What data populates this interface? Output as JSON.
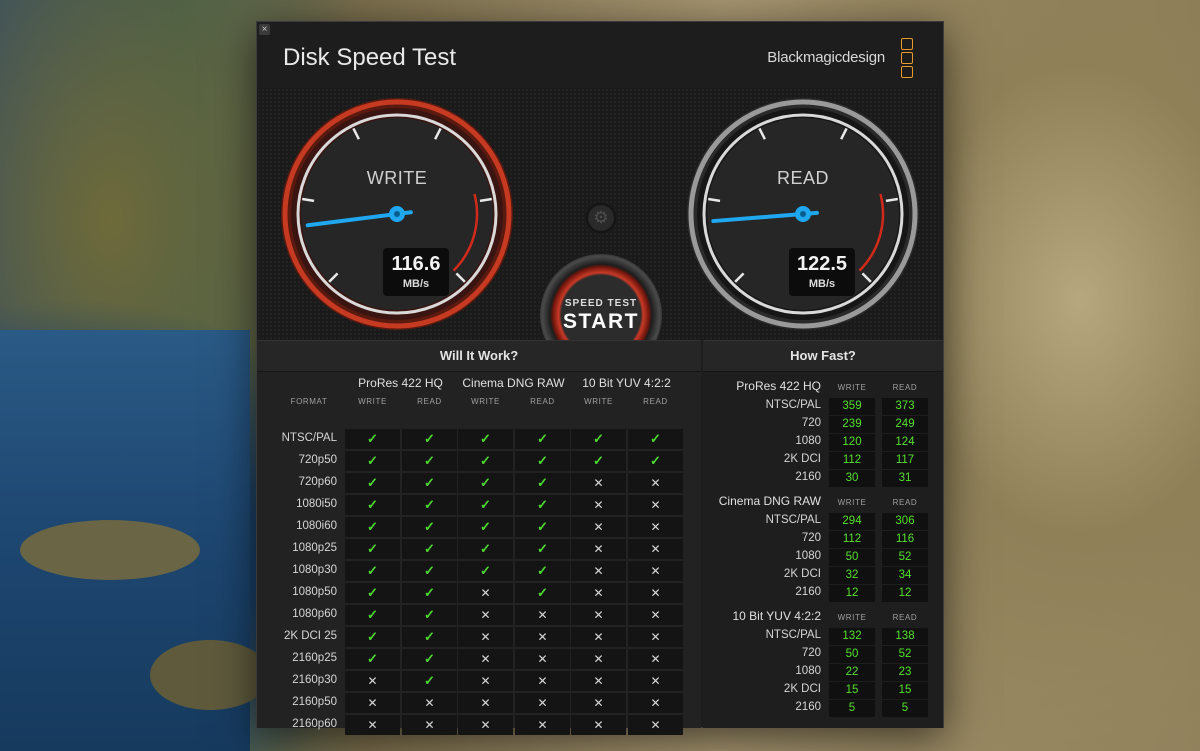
{
  "app": {
    "close_icon_glyph": "×",
    "title": "Disk Speed Test",
    "brand": "Blackmagicdesign"
  },
  "gauges": {
    "write": {
      "label": "WRITE",
      "value": "116.6",
      "unit": "MB/s",
      "needle_fraction": 0.14
    },
    "read": {
      "label": "READ",
      "value": "122.5",
      "unit": "MB/s",
      "needle_fraction": 0.15
    }
  },
  "controls": {
    "settings_icon": "gear-icon",
    "start_small": "SPEED TEST",
    "start_big": "START"
  },
  "will_it_work": {
    "title": "Will It Work?",
    "format_header": "FORMAT",
    "groups": [
      "ProRes 422 HQ",
      "Cinema DNG RAW",
      "10 Bit YUV 4:2:2"
    ],
    "sub_headers": [
      "WRITE",
      "READ",
      "WRITE",
      "READ",
      "WRITE",
      "READ"
    ],
    "yes_glyph": "✓",
    "no_glyph": "✕",
    "rows": [
      {
        "format": "NTSC/PAL",
        "cells": [
          1,
          1,
          1,
          1,
          1,
          1
        ]
      },
      {
        "format": "720p50",
        "cells": [
          1,
          1,
          1,
          1,
          1,
          1
        ]
      },
      {
        "format": "720p60",
        "cells": [
          1,
          1,
          1,
          1,
          0,
          0
        ]
      },
      {
        "format": "1080i50",
        "cells": [
          1,
          1,
          1,
          1,
          0,
          0
        ]
      },
      {
        "format": "1080i60",
        "cells": [
          1,
          1,
          1,
          1,
          0,
          0
        ]
      },
      {
        "format": "1080p25",
        "cells": [
          1,
          1,
          1,
          1,
          0,
          0
        ]
      },
      {
        "format": "1080p30",
        "cells": [
          1,
          1,
          1,
          1,
          0,
          0
        ]
      },
      {
        "format": "1080p50",
        "cells": [
          1,
          1,
          0,
          1,
          0,
          0
        ]
      },
      {
        "format": "1080p60",
        "cells": [
          1,
          1,
          0,
          0,
          0,
          0
        ]
      },
      {
        "format": "2K DCI 25",
        "cells": [
          1,
          1,
          0,
          0,
          0,
          0
        ]
      },
      {
        "format": "2160p25",
        "cells": [
          1,
          1,
          0,
          0,
          0,
          0
        ]
      },
      {
        "format": "2160p30",
        "cells": [
          0,
          1,
          0,
          0,
          0,
          0
        ]
      },
      {
        "format": "2160p50",
        "cells": [
          0,
          0,
          0,
          0,
          0,
          0
        ]
      },
      {
        "format": "2160p60",
        "cells": [
          0,
          0,
          0,
          0,
          0,
          0
        ]
      }
    ]
  },
  "how_fast": {
    "title": "How Fast?",
    "write_label": "WRITE",
    "read_label": "READ",
    "groups": [
      {
        "name": "ProRes 422 HQ",
        "rows": [
          {
            "format": "NTSC/PAL",
            "write": "359",
            "read": "373"
          },
          {
            "format": "720",
            "write": "239",
            "read": "249"
          },
          {
            "format": "1080",
            "write": "120",
            "read": "124"
          },
          {
            "format": "2K DCI",
            "write": "112",
            "read": "117"
          },
          {
            "format": "2160",
            "write": "30",
            "read": "31"
          }
        ]
      },
      {
        "name": "Cinema DNG RAW",
        "rows": [
          {
            "format": "NTSC/PAL",
            "write": "294",
            "read": "306"
          },
          {
            "format": "720",
            "write": "112",
            "read": "116"
          },
          {
            "format": "1080",
            "write": "50",
            "read": "52"
          },
          {
            "format": "2K DCI",
            "write": "32",
            "read": "34"
          },
          {
            "format": "2160",
            "write": "12",
            "read": "12"
          }
        ]
      },
      {
        "name": "10 Bit YUV 4:2:2",
        "rows": [
          {
            "format": "NTSC/PAL",
            "write": "132",
            "read": "138"
          },
          {
            "format": "720",
            "write": "50",
            "read": "52"
          },
          {
            "format": "1080",
            "write": "22",
            "read": "23"
          },
          {
            "format": "2K DCI",
            "write": "15",
            "read": "15"
          },
          {
            "format": "2160",
            "write": "5",
            "read": "5"
          }
        ]
      }
    ]
  },
  "colors": {
    "accent_green": "#4ddb30",
    "needle_blue": "#1fa7f0",
    "write_ring_red": "#c63a22",
    "brand_orange": "#e89a2c"
  }
}
